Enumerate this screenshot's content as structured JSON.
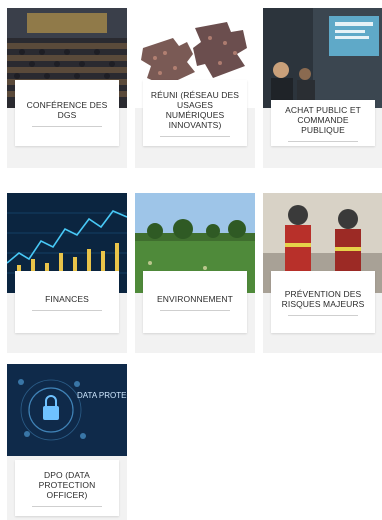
{
  "tiles": [
    {
      "label": "CONFÉRENCE DES DGS",
      "image": "conference-hall-photo"
    },
    {
      "label": "RéUNI (RÉSEAU DES USAGES NUMÉRIQUES INNOVANTS)",
      "image": "puzzle-crowd-photo"
    },
    {
      "label": "ACHAT PUBLIC ET COMMANDE PUBLIQUE",
      "image": "presentation-room-photo"
    },
    {
      "label": "FINANCES",
      "image": "stock-chart-photo"
    },
    {
      "label": "ENVIRONNEMENT",
      "image": "field-trees-photo"
    },
    {
      "label": "PRÉVENTION DES RISQUES MAJEURS",
      "image": "firefighters-photo"
    },
    {
      "label": "DPO (DATA PROTECTION OFFICER)",
      "image": "data-protection-photo",
      "image_text": "DATA PROTECTION"
    }
  ]
}
